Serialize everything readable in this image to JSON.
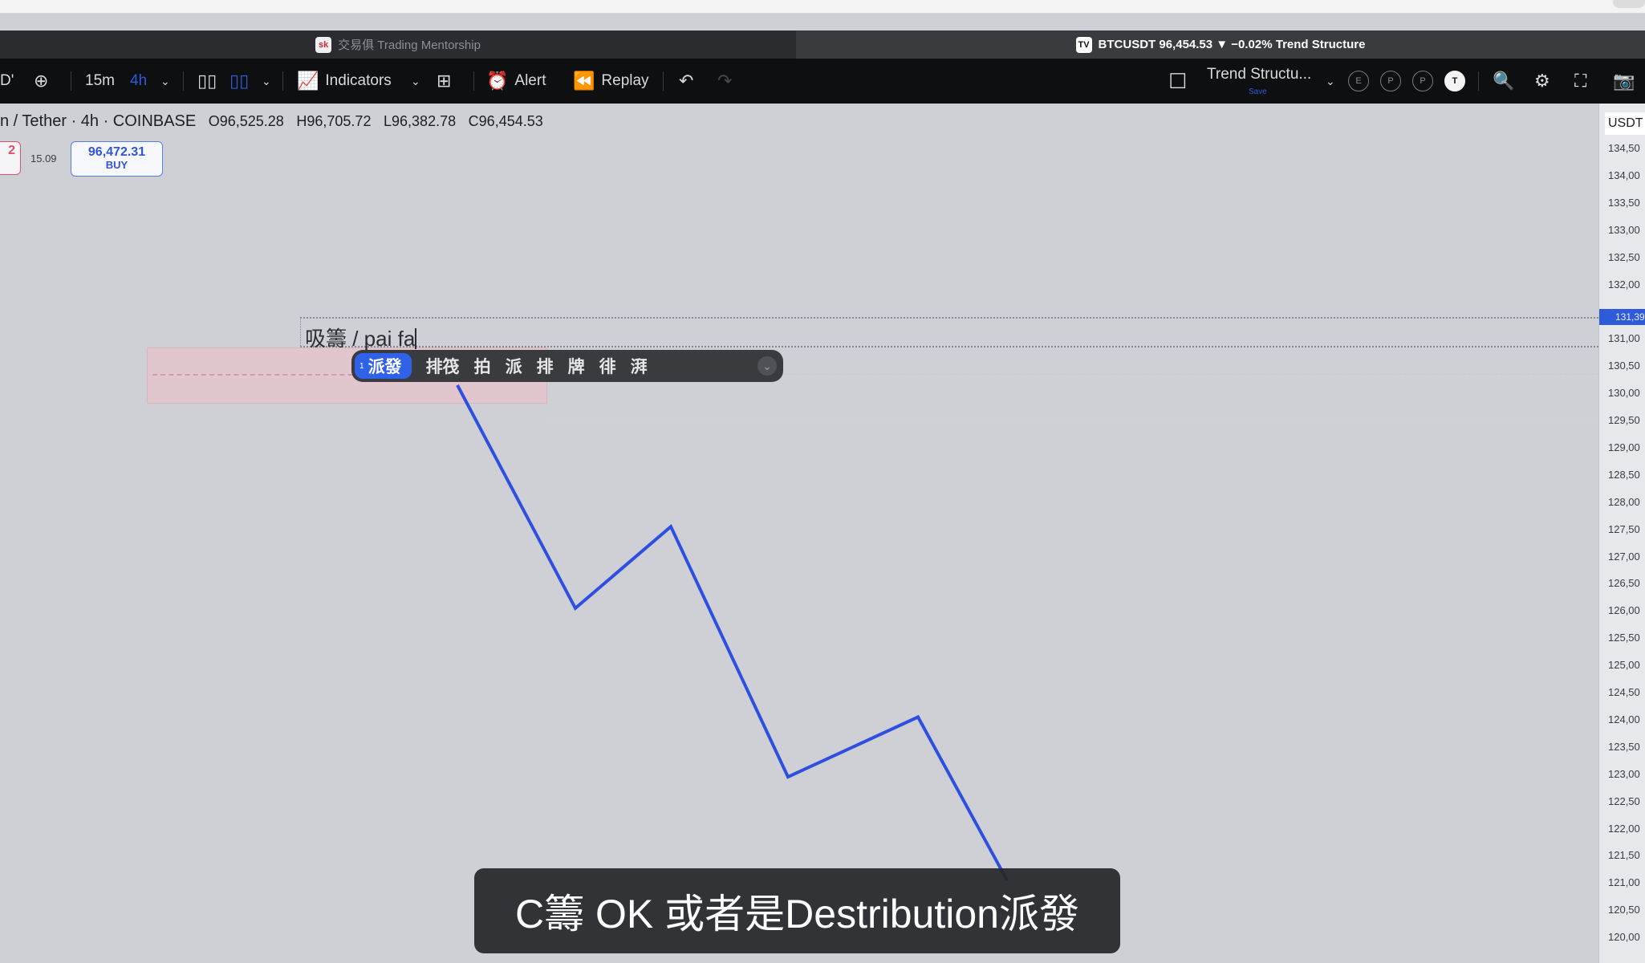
{
  "browser": {
    "tabs": [
      {
        "label": "交易俱 Trading Mentorship",
        "favicon": "sk"
      },
      {
        "label": "BTCUSDT 96,454.53 ▼ −0.02% Trend Structure",
        "favicon": "TV"
      }
    ]
  },
  "toolbar": {
    "symbol_fragment": "D'",
    "timeframes": [
      "15m",
      "4h"
    ],
    "indicators_label": "Indicators",
    "alert_label": "Alert",
    "replay_label": "Replay",
    "layout_name": "Trend Structu...",
    "layout_sub": "Save",
    "circles": [
      "E",
      "P",
      "P",
      "T"
    ]
  },
  "chart": {
    "symbol_line": "n / Tether · 4h · COINBASE",
    "open": "O96,525.28",
    "high": "H96,705.72",
    "low": "L96,382.78",
    "close": "C96,454.53",
    "sell_price_fragment": "2",
    "spread": "15.09",
    "buy_price": "96,472.31",
    "buy_label": "BUY",
    "axis_unit": "USDT",
    "price_ticks": [
      "134,50",
      "134,00",
      "133,50",
      "133,00",
      "132,50",
      "132,00",
      "131,00",
      "130,50",
      "130,00",
      "129,50",
      "129,00",
      "128,50",
      "128,00",
      "127,50",
      "127,00",
      "126,50",
      "126,00",
      "125,50",
      "125,00",
      "124,50",
      "124,00",
      "123,50",
      "123,00",
      "122,50",
      "122,00",
      "121,50",
      "121,00",
      "120,50",
      "120,00"
    ],
    "current_price_tag": "131,39",
    "line_color": "#2f4fe0",
    "polyline_price_points": [
      {
        "price": 130.15
      },
      {
        "price": 126.05
      },
      {
        "price": 127.55
      },
      {
        "price": 122.95
      },
      {
        "price": 124.05
      },
      {
        "price": 121.05
      }
    ]
  },
  "drawing_text": {
    "typed": "吸籌 / pai fa"
  },
  "ime": {
    "selected_index": "1",
    "candidates": [
      "派發",
      "排筏",
      "拍",
      "派",
      "排",
      "牌",
      "徘",
      "湃"
    ],
    "more_icon": "chevron-down-icon"
  },
  "subtitle": "C籌 OK 或者是Destribution派發"
}
